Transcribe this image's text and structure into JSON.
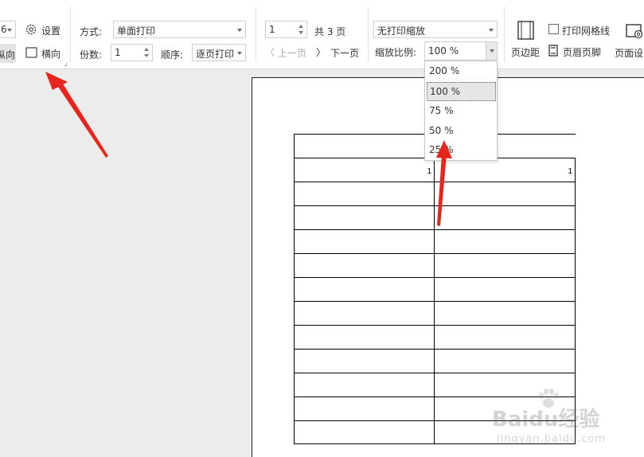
{
  "toolbar": {
    "paper_cut": "6",
    "settings_label": "设置",
    "portrait_label": "纵向",
    "landscape_label": "横向",
    "mode_label": "方式:",
    "mode_value": "单面打印",
    "copies_label": "份数:",
    "copies_value": "1",
    "order_label": "顺序:",
    "order_value": "逐页打印",
    "page_input_value": "1",
    "total_pages": "共 3 页",
    "prev_page": "上一页",
    "next_page": "下一页",
    "scale_mode_value": "无打印缩放",
    "zoom_label": "缩放比例:",
    "zoom_value": "100 %",
    "margins_label": "页边距",
    "print_gridlines_label": "打印网格线",
    "header_footer_label": "页眉页脚",
    "page_setup_label": "页面设"
  },
  "zoom_dropdown": {
    "options": [
      "200 %",
      "100 %",
      "75 %",
      "50 %",
      "25 %"
    ],
    "selected": "100 %"
  },
  "document": {
    "row1_col1_value": "1",
    "row1_col2_value": "1"
  },
  "watermark": {
    "brand": "Baidu经验",
    "url": "jingyan.baidu.com"
  },
  "colors": {
    "annotation_arrow": "#e8251c",
    "toolbar_bg": "#ffffff",
    "canvas_bg": "#ececec"
  }
}
